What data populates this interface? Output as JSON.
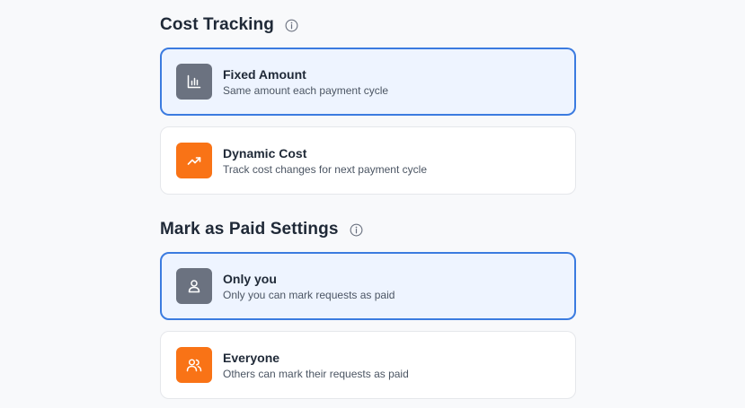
{
  "cost_tracking": {
    "title": "Cost Tracking",
    "options": [
      {
        "title": "Fixed Amount",
        "description": "Same amount each payment cycle",
        "icon": "bar-chart-icon",
        "selected": true
      },
      {
        "title": "Dynamic Cost",
        "description": "Track cost changes for next payment cycle",
        "icon": "trending-up-icon",
        "selected": false
      }
    ]
  },
  "mark_paid": {
    "title": "Mark as Paid Settings",
    "options": [
      {
        "title": "Only you",
        "description": "Only you can mark requests as paid",
        "icon": "user-icon",
        "selected": true
      },
      {
        "title": "Everyone",
        "description": "Others can mark their requests as paid",
        "icon": "users-icon",
        "selected": false
      }
    ]
  },
  "colors": {
    "selected_border": "#3b7be0",
    "selected_bg": "#eef4ff",
    "gray_icon_bg": "#6b7280",
    "orange_icon_bg": "#f97316"
  }
}
